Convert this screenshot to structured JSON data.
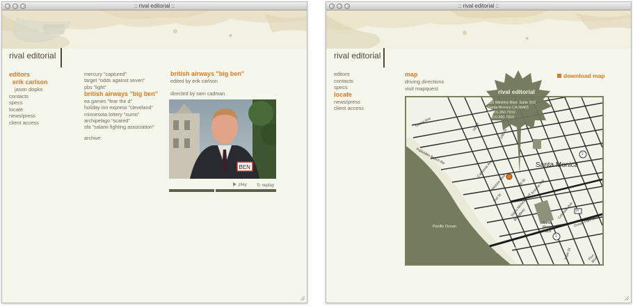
{
  "left_window": {
    "title": ":: rival editorial ::",
    "brand": "rival editorial",
    "nav": {
      "editors": "editors",
      "editor_selected": "erik carlson",
      "editor_other": "jason dopko",
      "items": [
        "contacts",
        "specs",
        "locate",
        "news/press",
        "client access"
      ]
    },
    "projects": {
      "items_before": [
        "mercury \"captured\"",
        "target \"odds against seven\"",
        "pbs \"light\""
      ],
      "selected": "british airways \"big ben\"",
      "items_after": [
        "ea games \"fear the d\"",
        "holiday inn express \"cleveland\"",
        "minnesota lottery \"sumo\"",
        "archipelago \"scared\"",
        "sfa \"salami fighting association\""
      ],
      "archive": "archive:"
    },
    "detail": {
      "title": "british airways \"big ben\"",
      "edited_by": "edited by erik carlson",
      "directed_by": "directed by sam cadman",
      "badge": "BEN",
      "play": "play",
      "replay": "replay",
      "progress": 0.42
    }
  },
  "right_window": {
    "title": ":: rival editorial ::",
    "brand": "rival editorial",
    "nav": {
      "items_top": [
        "editors",
        "contacts",
        "specs"
      ],
      "selected": "locate",
      "items_bottom": [
        "news/press",
        "client access"
      ]
    },
    "map_menu": {
      "title": "map",
      "items": [
        "driving directions",
        "visit mapquest"
      ]
    },
    "download": "download map",
    "burst": {
      "title": "rival editorial",
      "address": [
        "325 Wilshire Blvd. Suite 203",
        "Santa Monica CA 90401",
        "p. 310.260.7910",
        "f. 310.260.7910"
      ]
    },
    "map_labels": {
      "santa_monica": "Santa Monica",
      "pacific_ocean": "Pacific Ocean",
      "beach": "Santa Monica State Beach",
      "place": "Santa Monica Place",
      "streets": [
        "Ocean Ave",
        "Palisades Beach Rd",
        "Wilshire Blvd",
        "California Ave",
        "Arizona Ave",
        "Santa Monica Blvd",
        "Broadway",
        "Colorado Ave",
        "Ocean Park Blvd",
        "Pico Blvd",
        "Main St",
        "4th St",
        "2nd St",
        "7th St",
        "10th St"
      ],
      "shields": [
        "2",
        "1",
        "10"
      ]
    }
  }
}
